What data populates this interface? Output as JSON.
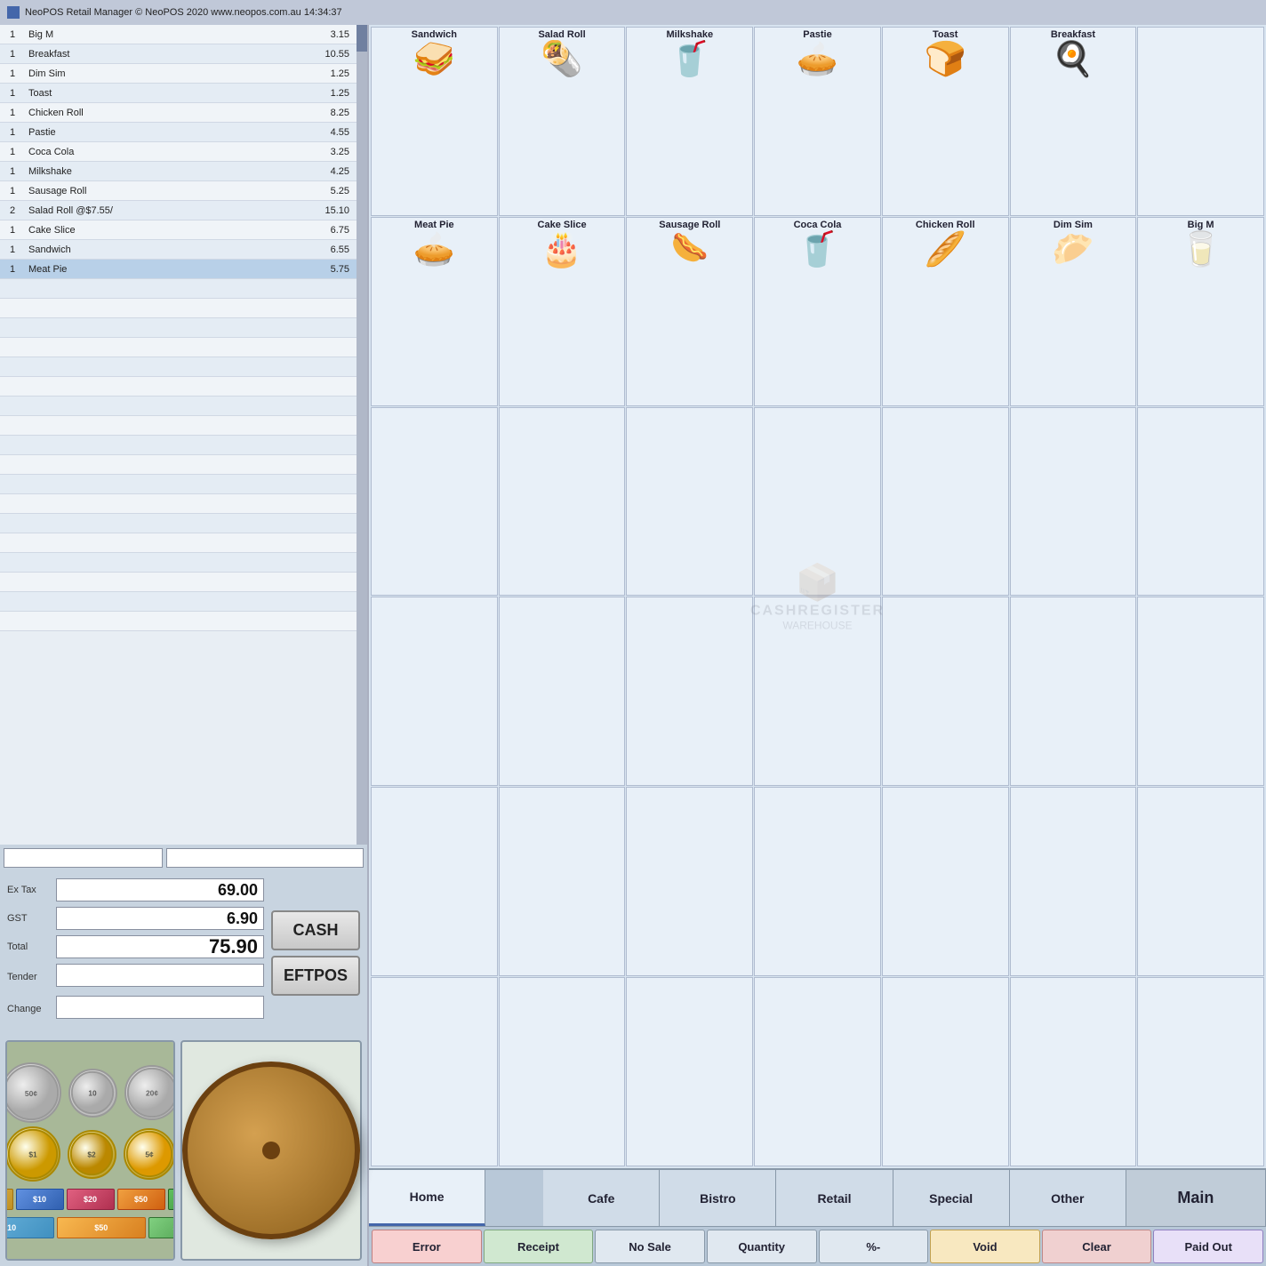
{
  "titlebar": {
    "logo": "■",
    "text": "NeoPOS Retail Manager  © NeoPOS 2020  www.neopos.com.au  14:34:37"
  },
  "order_list": {
    "columns": [
      "qty",
      "name",
      "price"
    ],
    "rows": [
      {
        "qty": "1",
        "name": "Big M",
        "price": "3.15",
        "selected": false
      },
      {
        "qty": "1",
        "name": "Breakfast",
        "price": "10.55",
        "selected": false
      },
      {
        "qty": "1",
        "name": "Dim Sim",
        "price": "1.25",
        "selected": false
      },
      {
        "qty": "1",
        "name": "Toast",
        "price": "1.25",
        "selected": false
      },
      {
        "qty": "1",
        "name": "Chicken Roll",
        "price": "8.25",
        "selected": false
      },
      {
        "qty": "1",
        "name": "Pastie",
        "price": "4.55",
        "selected": false
      },
      {
        "qty": "1",
        "name": "Coca Cola",
        "price": "3.25",
        "selected": false
      },
      {
        "qty": "1",
        "name": "Milkshake",
        "price": "4.25",
        "selected": false
      },
      {
        "qty": "1",
        "name": "Sausage Roll",
        "price": "5.25",
        "selected": false
      },
      {
        "qty": "2",
        "name": "Salad Roll @$7.55/",
        "price": "15.10",
        "selected": false
      },
      {
        "qty": "1",
        "name": "Cake Slice",
        "price": "6.75",
        "selected": false
      },
      {
        "qty": "1",
        "name": "Sandwich",
        "price": "6.55",
        "selected": false
      },
      {
        "qty": "1",
        "name": "Meat Pie",
        "price": "5.75",
        "selected": true
      }
    ],
    "empty_rows": 18
  },
  "search_bar1": {
    "value": ""
  },
  "search_bar2": {
    "value": ""
  },
  "totals": {
    "ex_tax_label": "Ex Tax",
    "ex_tax_value": "69.00",
    "gst_label": "GST",
    "gst_value": "6.90",
    "total_label": "Total",
    "total_value": "75.90",
    "tender_label": "Tender",
    "tender_value": "",
    "change_label": "Change",
    "change_value": ""
  },
  "payment": {
    "cash_label": "CASH",
    "eftpos_label": "EFTPOS"
  },
  "products": {
    "row1": [
      {
        "label": "Sandwich",
        "emoji": "🥪"
      },
      {
        "label": "Salad Roll",
        "emoji": "🌯"
      },
      {
        "label": "Milkshake",
        "emoji": "🥤"
      },
      {
        "label": "Pastie",
        "emoji": "🥧"
      },
      {
        "label": "Toast",
        "emoji": "🍞"
      },
      {
        "label": "Breakfast",
        "emoji": "🍳"
      },
      {
        "label": "",
        "emoji": ""
      }
    ],
    "row2": [
      {
        "label": "Meat Pie",
        "emoji": "🥧"
      },
      {
        "label": "Cake Slice",
        "emoji": "🎂"
      },
      {
        "label": "Sausage Roll",
        "emoji": "🌭"
      },
      {
        "label": "Coca Cola",
        "emoji": "🥤"
      },
      {
        "label": "Chicken Roll",
        "emoji": "🥖"
      },
      {
        "label": "Dim Sim",
        "emoji": "🥟"
      },
      {
        "label": "Big M",
        "emoji": "🥛"
      }
    ]
  },
  "categories": {
    "home": "Home",
    "cafe": "Cafe",
    "bistro": "Bistro",
    "retail": "Retail",
    "special": "Special",
    "other": "Other",
    "main": "Main"
  },
  "actions": {
    "error": "Error",
    "receipt": "Receipt",
    "no_sale": "No Sale",
    "quantity": "Quantity",
    "percent": "%-",
    "void": "Void",
    "clear": "Clear",
    "paid_out": "Paid Out"
  },
  "watermark": {
    "text": "CASHREGISTER",
    "sub": "WAREHOUSE"
  }
}
